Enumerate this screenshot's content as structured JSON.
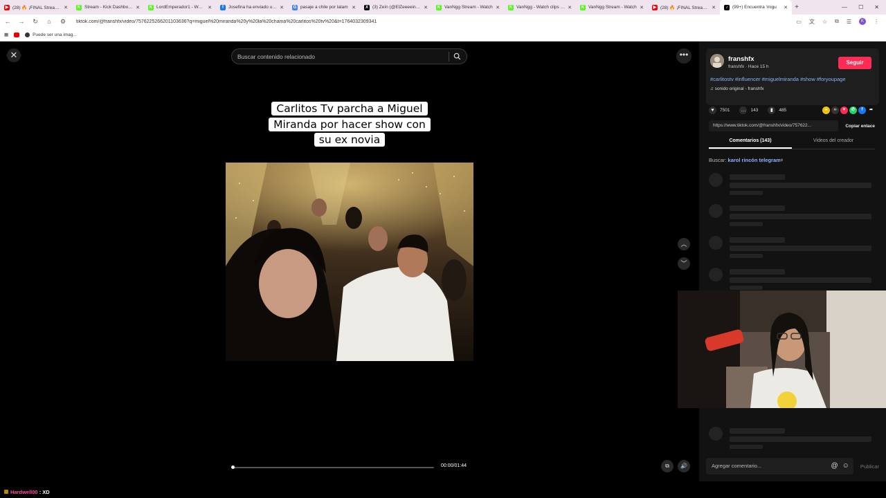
{
  "browser": {
    "tabs": [
      {
        "title": "(28) 🔥 ¡FINAL Stream y S",
        "fav_color": "#ff0000",
        "fav_glyph": "▶"
      },
      {
        "title": "Stream - Kick Dashboard",
        "fav_color": "#53fc18",
        "fav_glyph": "K"
      },
      {
        "title": "LordEmperador1 - Watch",
        "fav_color": "#53fc18",
        "fav_glyph": "K"
      },
      {
        "title": "Josefina ha enviado un m",
        "fav_color": "#1877f2",
        "fav_glyph": "f"
      },
      {
        "title": "pasaje a chile por latam",
        "fav_color": "#4285f4",
        "fav_glyph": "G"
      },
      {
        "title": "(3) Zeín (@ElZeeeein) / X",
        "fav_color": "#000000",
        "fav_glyph": "X"
      },
      {
        "title": "VanNgg Stream - Watch",
        "fav_color": "#53fc18",
        "fav_glyph": "K"
      },
      {
        "title": "VanNgg - Watch clips on",
        "fav_color": "#53fc18",
        "fav_glyph": "K"
      },
      {
        "title": "VanNgg Stream - Watch",
        "fav_color": "#53fc18",
        "fav_glyph": "K"
      },
      {
        "title": "(28) 🔥 ¡FINAL Stream y S",
        "fav_color": "#ff0000",
        "fav_glyph": "▶"
      },
      {
        "title": "(99+) Encuentra 'migu",
        "fav_color": "#000000",
        "fav_glyph": "♪"
      }
    ],
    "url": "tiktok.com/@franshfx/video/7576225266201103636?q=miguel%20miranda%20y%20la%20chama%20carlitos%20tv%20&t=1764032309341",
    "bookmark_label": "Puede ser una imag..."
  },
  "page": {
    "search_placeholder": "Buscar contenido relacionado",
    "caption": [
      "Carlitos Tv parcha a Miguel",
      "Miranda por hacer show con",
      "su ex novia"
    ],
    "timecode": "00:00/01:44",
    "progress_fraction": 0.0
  },
  "panel": {
    "author_name": "franshfx",
    "author_sub": "franshfx · Hace 15 h",
    "follow_label": "Seguir",
    "hashtags": "#carlitostv #influencer #miguelmiranda #show #foryoupage",
    "sound": "sonido original - franshfx",
    "likes": "7501",
    "comments": "143",
    "saves": "485",
    "link": "https://www.tiktok.com/@franshfx/video/757622...",
    "copy_label": "Copiar enlace",
    "tab_comments": "Comentarios (143)",
    "tab_creator": "Videos del creador",
    "search_prefix": "Buscar:",
    "search_term": "karol rincón telegram",
    "comment_placeholder": "Agregar comentario...",
    "publish_label": "Publicar"
  },
  "chat": {
    "user": "Hardwell00",
    "sep": " : ",
    "text": "XD"
  }
}
